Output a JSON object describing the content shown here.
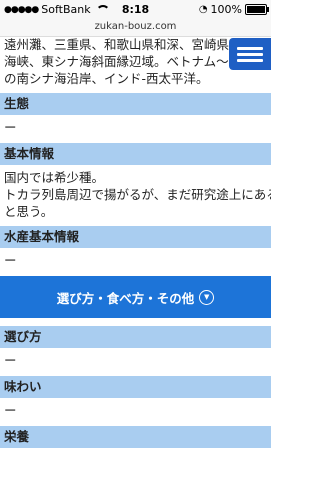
{
  "status": {
    "carrier": "SoftBank",
    "time": "8:18",
    "battery": "100%"
  },
  "url": "zukan-bouz.com",
  "habitat_lines": [
    "遠州灘、三重県、和歌山県和深、宮崎県、東シナ",
    "海峡、東シナ海斜面縁辺域。ベトナム〜フィリピ",
    "の南シナ海沿岸、インド-西太平洋。"
  ],
  "sections": {
    "ecology": {
      "title": "生態",
      "value": "ー"
    },
    "basic": {
      "title": "基本情報",
      "lines": [
        "国内では希少種。",
        "トカラ列島周辺で揚がるが、まだ研究途上にある",
        "と思う。"
      ]
    },
    "fishery": {
      "title": "水産基本情報",
      "value": "ー"
    },
    "banner": "選び方・食べ方・その他",
    "selection": {
      "title": "選び方",
      "value": "ー"
    },
    "taste": {
      "title": "味わい",
      "value": "ー"
    },
    "nutrition": {
      "title": "栄養"
    }
  },
  "colors": {
    "section_bg": "#a9cdf0",
    "banner_bg": "#1d74d8",
    "menu_bg": "#1f5fc4"
  }
}
